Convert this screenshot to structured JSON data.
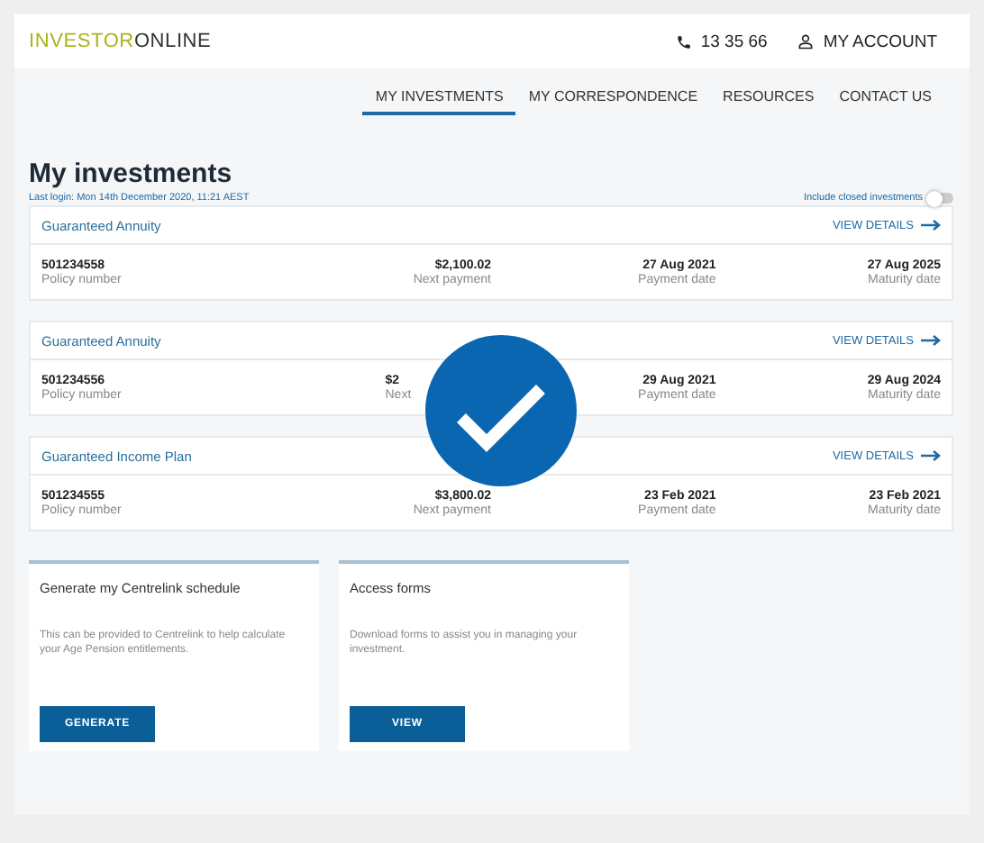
{
  "header": {
    "logo": {
      "part1": "INVESTOR",
      "part2": "ONLINE"
    },
    "phone": "13 35 66",
    "account": "MY ACCOUNT"
  },
  "nav": [
    {
      "label": "MY INVESTMENTS",
      "selected": true
    },
    {
      "label": "MY CORRESPONDENCE",
      "selected": false
    },
    {
      "label": "RESOURCES",
      "selected": false
    },
    {
      "label": "CONTACT US",
      "selected": false
    }
  ],
  "title": "My investments",
  "last_login": "Last login: Mon 14th December 2020, 11:21 AEST",
  "include_closed": {
    "label": "Include closed investments",
    "on": false
  },
  "investments": [
    {
      "name": "Guaranteed Annuity",
      "link": "VIEW DETAILS",
      "fields": [
        {
          "value": "501234558",
          "label": "Policy number"
        },
        {
          "value": "$2,100.02",
          "label": "Next payment"
        },
        {
          "value": "27 Aug 2021",
          "label": "Payment date"
        },
        {
          "value": "27 Aug 2025",
          "label": "Maturity date"
        }
      ]
    },
    {
      "name": "Guaranteed Annuity",
      "link": "VIEW DETAILS",
      "fields": [
        {
          "value": "501234556",
          "label": "Policy number"
        },
        {
          "value": "$2",
          "label": "Next",
          "covered": true
        },
        {
          "value": "29 Aug 2021",
          "label": "Payment date"
        },
        {
          "value": "29 Aug 2024",
          "label": "Maturity date"
        }
      ]
    },
    {
      "name": "Guaranteed Income Plan",
      "link": "VIEW DETAILS",
      "fields": [
        {
          "value": "501234555",
          "label": "Policy number"
        },
        {
          "value": "$3,800.02",
          "label": "Next payment"
        },
        {
          "value": "23 Feb 2021",
          "label": "Payment date"
        },
        {
          "value": "23 Feb 2021",
          "label": "Maturity date"
        }
      ]
    }
  ],
  "tiles": [
    {
      "title": "Generate my Centrelink schedule",
      "text": "This can be provided to Centrelink to help calculate your Age Pension entitlements.",
      "button": "GENERATE"
    },
    {
      "title": "Access forms",
      "text": "Download forms to assist you in managing your investment.",
      "button": "VIEW"
    }
  ],
  "overlay": {
    "kind": "checkmark"
  }
}
